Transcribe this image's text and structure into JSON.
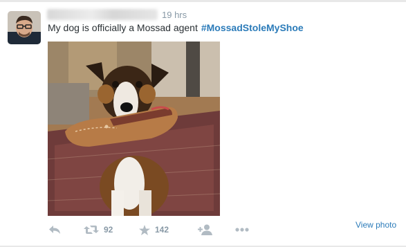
{
  "tweet": {
    "author_name": "",
    "timestamp": "19 hrs",
    "text": "My dog is officially a Mossad agent",
    "hashtag": "#MossadStoleMyShoe"
  },
  "actions": {
    "reply_icon": "reply-icon",
    "retweet_icon": "retweet-icon",
    "retweet_count": "92",
    "favorite_icon": "star-icon",
    "favorite_count": "142",
    "follow_icon": "follow-icon",
    "more_icon": "more-dots-icon",
    "view_photo_label": "View photo"
  },
  "colors": {
    "link": "#2b7bb9",
    "muted": "#8899a6",
    "icon": "#b1bbc3",
    "text": "#292f33"
  }
}
